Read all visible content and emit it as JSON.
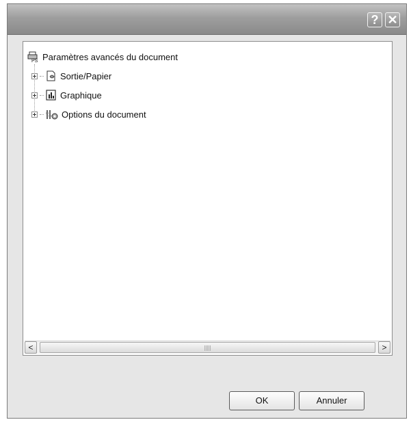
{
  "titlebar": {
    "help_label": "?",
    "close_label": "✕"
  },
  "tree": {
    "root": {
      "label": "Paramètres avancés du document",
      "icon": "printer-ps-icon"
    },
    "children": [
      {
        "label": "Sortie/Papier",
        "icon": "paper-output-icon"
      },
      {
        "label": "Graphique",
        "icon": "graphics-chart-icon"
      },
      {
        "label": "Options du document",
        "icon": "document-options-icon"
      }
    ]
  },
  "scrollbar": {
    "left_arrow": "<",
    "right_arrow": ">"
  },
  "buttons": {
    "ok_label": "OK",
    "cancel_label": "Annuler"
  }
}
